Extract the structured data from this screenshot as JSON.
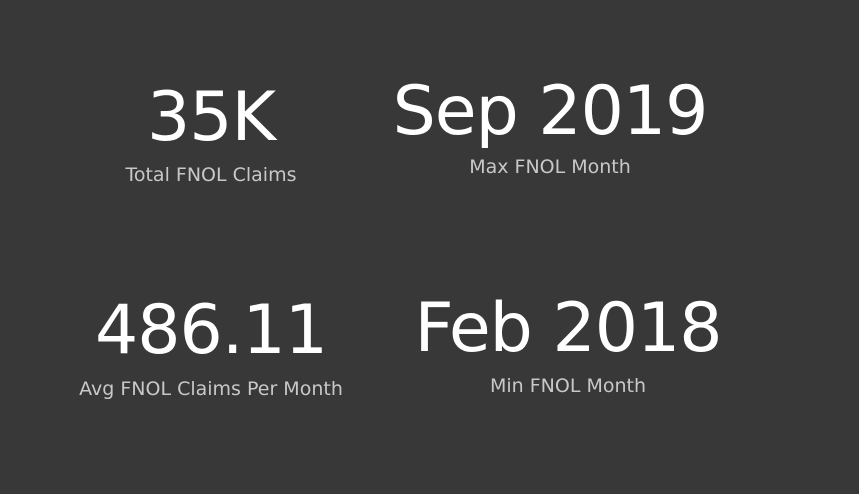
{
  "cards": [
    {
      "value": "35K",
      "label": "Total FNOL Claims"
    },
    {
      "value": "Sep 2019",
      "label": "Max FNOL Month"
    },
    {
      "value": "486.11",
      "label": "Avg FNOL Claims Per Month"
    },
    {
      "value": "Feb 2018",
      "label": "Min FNOL Month"
    }
  ],
  "colors": {
    "background": "#383838",
    "value_text": "#ffffff",
    "label_text": "#c8c8c8"
  }
}
